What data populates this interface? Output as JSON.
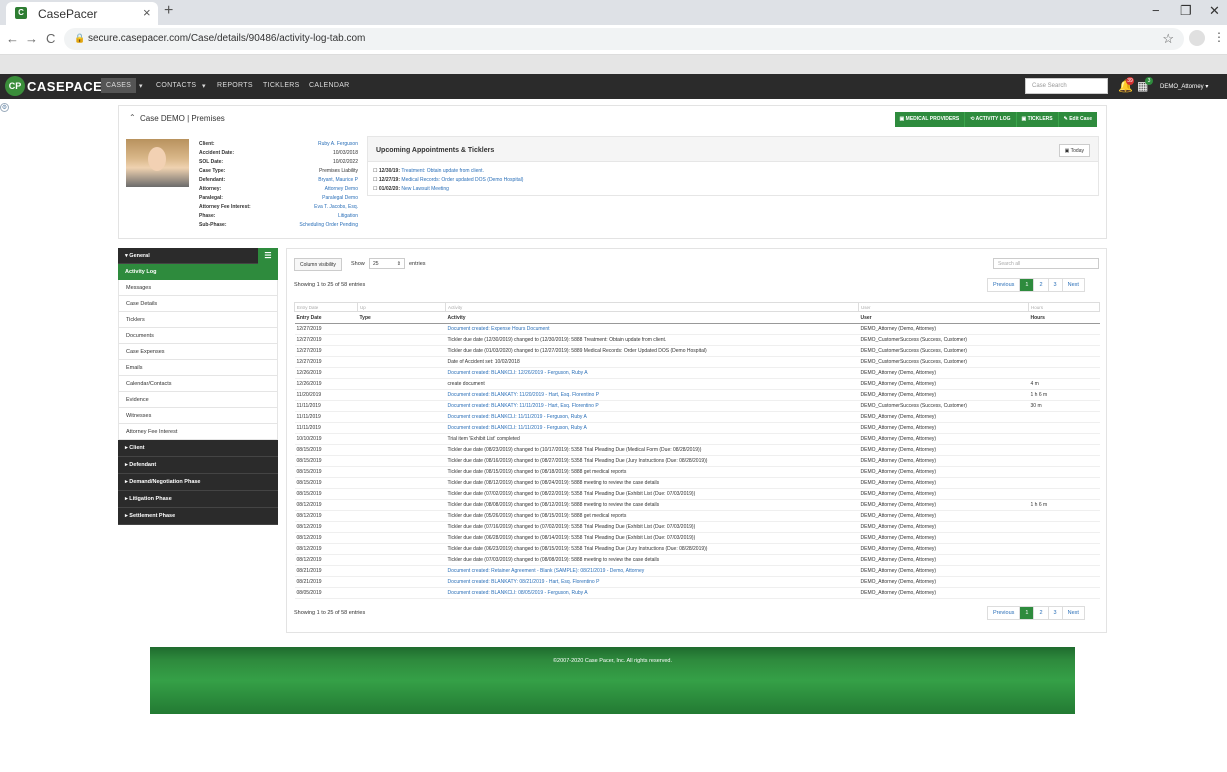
{
  "browser": {
    "tab_title": "CasePacer",
    "tab_close": "×",
    "new_tab": "+",
    "window_min": "−",
    "window_max": "❐",
    "window_close": "✕",
    "back": "←",
    "forward": "→",
    "reload": "C",
    "lock": "🔒",
    "url": "secure.casepacer.com/Case/details/90486/activity-log-tab.com",
    "star": "☆",
    "menu": "⋮"
  },
  "appnav": {
    "logo_text": "CASEPACER",
    "items": [
      "CASES",
      "▾",
      "CONTACTS",
      "▾",
      "REPORTS",
      "TICKLERS",
      "CALENDAR"
    ],
    "search_placeholder": "Case Search",
    "notif_badge_1": "39",
    "notif_badge_2": "3",
    "user": "DEMO_Attorney ▾",
    "gear": "⚙"
  },
  "case": {
    "toggle": "⌃",
    "title": "Case DEMO | Premises",
    "actions": [
      "▣ MEDICAL PROVIDERS",
      "⟲ ACTIVITY LOG",
      "▣ TICKLERS",
      "✎ Edit Case"
    ],
    "fields": [
      {
        "label": "Client:",
        "value": "Ruby A. Ferguson",
        "link": true
      },
      {
        "label": "Accident Date:",
        "value": "10/03/2018",
        "link": false
      },
      {
        "label": "SOL Date:",
        "value": "10/02/2022",
        "link": false
      },
      {
        "label": "Case Type:",
        "value": "Premises Liability",
        "link": false
      },
      {
        "label": "Defendant:",
        "value": "Bryant, Maurice P",
        "link": true
      },
      {
        "label": "Attorney:",
        "value": "Attorney Demo",
        "link": true
      },
      {
        "label": "Paralegal:",
        "value": "Paralegal Demo",
        "link": true
      },
      {
        "label": "Attorney Fee Interest:",
        "value": "Eva T. Jacobs, Esq.",
        "link": true
      },
      {
        "label": "Phase:",
        "value": "Litigation",
        "link": true
      },
      {
        "label": "Sub-Phase:",
        "value": "Scheduling Order Pending",
        "link": true
      }
    ],
    "upcoming_title": "Upcoming Appointments & Ticklers",
    "today_label": "▣ Today",
    "appointments": [
      {
        "icon": "☐",
        "date": "12/30/19:",
        "text": "Treatment: Obtain update from client."
      },
      {
        "icon": "☐",
        "date": "12/27/19:",
        "text": "Medical Records: Order updated DOS (Demo Hospital)"
      },
      {
        "icon": "☐",
        "date": "01/02/20:",
        "text": "New Lawsuit Meeting"
      }
    ]
  },
  "sidebar": {
    "general": "▾ General",
    "toggle_icon": "☰",
    "items": [
      "Activity Log",
      "Messages",
      "Case Details",
      "Ticklers",
      "Documents",
      "Case Expenses",
      "Emails",
      "Calendar/Contacts",
      "Evidence",
      "Witnesses",
      "Attorney Fee Interest"
    ],
    "sections": [
      "▸ Client",
      "▸ Defendant",
      "▸ Demand/Negotiation Phase",
      "▸ Litigation Phase",
      "▸ Settlement Phase"
    ]
  },
  "table": {
    "colvis": "Column visibility",
    "show": "Show",
    "show_value": "25",
    "entries": "entries",
    "search_placeholder": "Search all",
    "showing": "Showing 1 to 25 of 58 entries",
    "pager": [
      "Previous",
      "1",
      "2",
      "3",
      "Next"
    ],
    "filters": [
      "Entry Date",
      "Up",
      "Activity",
      "User",
      "Hours"
    ],
    "headers": [
      "Entry Date",
      "Type",
      "Activity",
      "User",
      "Hours"
    ],
    "rows": [
      {
        "date": "12/27/2019",
        "type": "",
        "activity": "Document created: Expense Hours Document",
        "link": true,
        "user": "DEMO_Attorney (Demo, Attorney)",
        "hours": ""
      },
      {
        "date": "12/27/2019",
        "type": "",
        "activity": "Tickler due date (12/30/2019) changed to (12/30/2019): 5888 Treatment: Obtain update from client.",
        "link": false,
        "user": "DEMO_CustomerSuccess (Success, Customer)",
        "hours": ""
      },
      {
        "date": "12/27/2019",
        "type": "",
        "activity": "Tickler due date (01/03/2020) changed to (12/27/2019): 5889 Medical Records: Order Updated DOS (Demo Hospital)",
        "link": false,
        "user": "DEMO_CustomerSuccess (Success, Customer)",
        "hours": ""
      },
      {
        "date": "12/27/2019",
        "type": "",
        "activity": "Date of Accident set: 10/02/2018",
        "link": false,
        "user": "DEMO_CustomerSuccess (Success, Customer)",
        "hours": ""
      },
      {
        "date": "12/26/2019",
        "type": "",
        "activity": "Document created: BLANKCLI: 12/26/2019 - Ferguson, Ruby A",
        "link": true,
        "user": "DEMO_Attorney (Demo, Attorney)",
        "hours": ""
      },
      {
        "date": "12/26/2019",
        "type": "",
        "activity": "create document",
        "link": false,
        "user": "DEMO_Attorney (Demo, Attorney)",
        "hours": "4 m"
      },
      {
        "date": "11/20/2019",
        "type": "",
        "activity": "Document created: BLANKATY: 11/20/2019 - Hart, Esq. Florentino P",
        "link": true,
        "user": "DEMO_Attorney (Demo, Attorney)",
        "hours": "1 h 6 m"
      },
      {
        "date": "11/11/2019",
        "type": "",
        "activity": "Document created: BLANKATY: 11/11/2019 - Hart, Esq. Florentino P",
        "link": true,
        "user": "DEMO_CustomerSuccess (Success, Customer)",
        "hours": "30 m"
      },
      {
        "date": "11/11/2019",
        "type": "",
        "activity": "Document created: BLANKCLI: 11/11/2019 - Ferguson, Ruby A",
        "link": true,
        "user": "DEMO_Attorney (Demo, Attorney)",
        "hours": ""
      },
      {
        "date": "11/11/2019",
        "type": "",
        "activity": "Document created: BLANKCLI: 11/11/2019 - Ferguson, Ruby A",
        "link": true,
        "user": "DEMO_Attorney (Demo, Attorney)",
        "hours": ""
      },
      {
        "date": "10/10/2019",
        "type": "",
        "activity": "Trial item 'Exhibit List' completed",
        "link": false,
        "user": "DEMO_Attorney (Demo, Attorney)",
        "hours": ""
      },
      {
        "date": "08/15/2019",
        "type": "",
        "activity": "Tickler due date (08/23/2019) changed to (10/17/2019): 5358 Trial Pleading Due (Medical Form (Due: 08/28/2019))",
        "link": false,
        "user": "DEMO_Attorney (Demo, Attorney)",
        "hours": ""
      },
      {
        "date": "08/15/2019",
        "type": "",
        "activity": "Tickler due date (08/16/2019) changed to (08/27/2019): 5358 Trial Pleading Due (Jury Instructions (Due: 08/28/2019))",
        "link": false,
        "user": "DEMO_Attorney (Demo, Attorney)",
        "hours": ""
      },
      {
        "date": "08/15/2019",
        "type": "",
        "activity": "Tickler due date (08/15/2019) changed to (08/18/2019): 5888 get medical reports",
        "link": false,
        "user": "DEMO_Attorney (Demo, Attorney)",
        "hours": ""
      },
      {
        "date": "08/15/2019",
        "type": "",
        "activity": "Tickler due date (08/12/2019) changed to (08/24/2019): 5888 meeting to review the case details",
        "link": false,
        "user": "DEMO_Attorney (Demo, Attorney)",
        "hours": ""
      },
      {
        "date": "08/15/2019",
        "type": "",
        "activity": "Tickler due date (07/02/2019) changed to (08/22/2019): 5358 Trial Pleading Due (Exhibit List (Due: 07/03/2019))",
        "link": false,
        "user": "DEMO_Attorney (Demo, Attorney)",
        "hours": ""
      },
      {
        "date": "08/12/2019",
        "type": "",
        "activity": "Tickler due date (08/08/2019) changed to (08/12/2019): 5888 meeting to review the case details",
        "link": false,
        "user": "DEMO_Attorney (Demo, Attorney)",
        "hours": "1 h 6 m"
      },
      {
        "date": "08/12/2019",
        "type": "",
        "activity": "Tickler due date (05/26/2019) changed to (08/15/2019): 5888 get medical reports",
        "link": false,
        "user": "DEMO_Attorney (Demo, Attorney)",
        "hours": ""
      },
      {
        "date": "08/12/2019",
        "type": "",
        "activity": "Tickler due date (07/16/2019) changed to (07/02/2019): 5358 Trial Pleading Due (Exhibit List (Due: 07/03/2019))",
        "link": false,
        "user": "DEMO_Attorney (Demo, Attorney)",
        "hours": ""
      },
      {
        "date": "08/12/2019",
        "type": "",
        "activity": "Tickler due date (06/28/2019) changed to (08/14/2019): 5358 Trial Pleading Due (Exhibit List (Due: 07/03/2019))",
        "link": false,
        "user": "DEMO_Attorney (Demo, Attorney)",
        "hours": ""
      },
      {
        "date": "08/12/2019",
        "type": "",
        "activity": "Tickler due date (06/23/2019) changed to (08/15/2019): 5358 Trial Pleading Due (Jury Instructions (Due: 08/28/2019))",
        "link": false,
        "user": "DEMO_Attorney (Demo, Attorney)",
        "hours": ""
      },
      {
        "date": "08/12/2019",
        "type": "",
        "activity": "Tickler due date (07/03/2019) changed to (08/08/2019): 5888 meeting to review the case details",
        "link": false,
        "user": "DEMO_Attorney (Demo, Attorney)",
        "hours": ""
      },
      {
        "date": "08/21/2019",
        "type": "",
        "activity": "Document created: Retainer Agreement - Blank (SAMPLE): 08/21/2019 - Demo, Attorney",
        "link": true,
        "user": "DEMO_Attorney (Demo, Attorney)",
        "hours": ""
      },
      {
        "date": "08/21/2019",
        "type": "",
        "activity": "Document created: BLANKATY: 08/21/2019 - Hart, Esq. Florentino P",
        "link": true,
        "user": "DEMO_Attorney (Demo, Attorney)",
        "hours": ""
      },
      {
        "date": "08/05/2019",
        "type": "",
        "activity": "Document created: BLANKCLI: 08/05/2019 - Ferguson, Ruby A",
        "link": true,
        "user": "DEMO_Attorney (Demo, Attorney)",
        "hours": ""
      }
    ]
  },
  "footer": {
    "copyright": "©2007-2020 Case Pacer, Inc. All rights reserved."
  }
}
